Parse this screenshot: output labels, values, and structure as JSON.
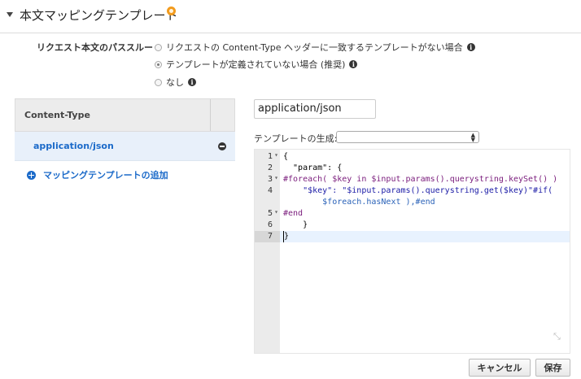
{
  "header": {
    "title": "本文マッピングテンプレート",
    "warning_icon": "warning-dot-icon"
  },
  "passthrough": {
    "label": "リクエスト本文のパススルー",
    "options": [
      {
        "label": "リクエストの Content-Type ヘッダーに一致するテンプレートがない場合",
        "selected": false
      },
      {
        "label": "テンプレートが定義されていない場合 (推奨)",
        "selected": true
      },
      {
        "label": "なし",
        "selected": false
      }
    ]
  },
  "content_types": {
    "header": "Content-Type",
    "rows": [
      {
        "label": "application/json"
      }
    ],
    "add_link": "マッピングテンプレートの追加"
  },
  "template": {
    "content_type_value": "application/json",
    "generate_label": "テンプレートの生成:",
    "generate_selected": ""
  },
  "editor": {
    "line_numbers": [
      "1",
      "2",
      "3",
      "4",
      "",
      "5",
      "6",
      "7"
    ],
    "lines": [
      "{",
      "  \"param\": {",
      "#foreach( $key in $input.params().querystring.keySet() )",
      "    \"$key\": \"$input.params().querystring.get($key)\"#if(",
      "        $foreach.hasNext ),#end",
      "#end",
      "    }",
      "}"
    ]
  },
  "buttons": {
    "cancel": "キャンセル",
    "save": "保存"
  },
  "colors": {
    "accent": "#1b6ac9",
    "warning": "#f29b1d",
    "selected_row": "#e8f0fa"
  }
}
